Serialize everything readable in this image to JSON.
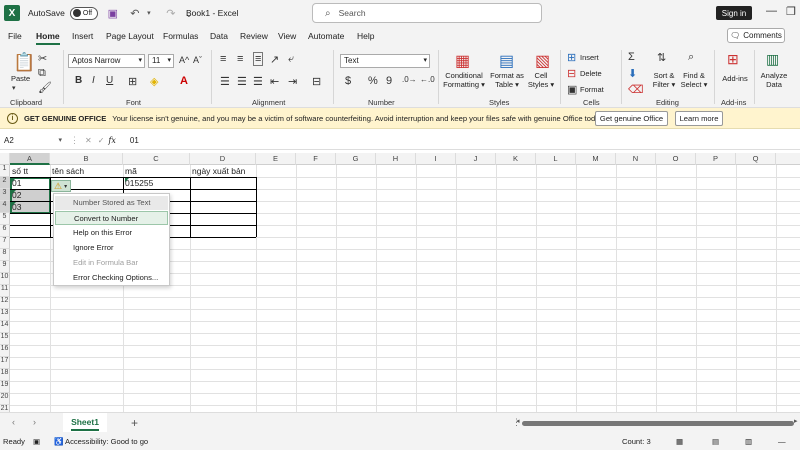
{
  "titlebar": {
    "app_icon": "excel-icon",
    "autosave_label": "AutoSave",
    "autosave_state": "Off",
    "title": "Book1 - Excel",
    "search_placeholder": "Search",
    "signin_label": "Sign in"
  },
  "menu": {
    "tabs": [
      "File",
      "Home",
      "Insert",
      "Page Layout",
      "Formulas",
      "Data",
      "Review",
      "View",
      "Automate",
      "Help"
    ],
    "active": "Home",
    "comments_label": "Comments"
  },
  "ribbon": {
    "clipboard": {
      "paste": "Paste",
      "label": "Clipboard"
    },
    "font": {
      "name": "Aptos Narrow",
      "size": "11",
      "bold": "B",
      "italic": "I",
      "underline": "U",
      "label": "Font"
    },
    "alignment": {
      "label": "Alignment"
    },
    "number": {
      "format": "Text",
      "currency": "$",
      "percent": "%",
      "comma": "9",
      "label": "Number"
    },
    "styles": {
      "conditional": [
        "Conditional",
        "Formatting ▾"
      ],
      "format_table": [
        "Format as",
        "Table ▾"
      ],
      "cell_styles": [
        "Cell",
        "Styles ▾"
      ],
      "label": "Styles"
    },
    "cells": {
      "insert": "Insert",
      "delete": "Delete",
      "format": "Format",
      "label": "Cells"
    },
    "editing": {
      "sort": [
        "Sort &",
        "Filter ▾"
      ],
      "find": [
        "Find &",
        "Select ▾"
      ],
      "label": "Editing"
    },
    "addins": {
      "addins": "Add-ins",
      "label": "Add-ins"
    },
    "analyze": [
      "Analyze",
      "Data"
    ]
  },
  "warning": {
    "title": "GET GENUINE OFFICE",
    "text": "Your license isn't genuine, and you may be a victim of software counterfeiting. Avoid interruption and keep your files safe with genuine Office today.",
    "btn_genuine": "Get genuine Office",
    "btn_learn": "Learn more"
  },
  "formula_bar": {
    "name_box": "A2",
    "fx": "fx",
    "value": "01"
  },
  "grid": {
    "columns": [
      "A",
      "B",
      "C",
      "D",
      "E",
      "F",
      "G",
      "H",
      "I",
      "J",
      "K",
      "L",
      "M",
      "N",
      "O",
      "P",
      "Q"
    ],
    "rows": [
      "1",
      "2",
      "3",
      "4",
      "5",
      "6",
      "7",
      "8",
      "9",
      "10",
      "11",
      "12",
      "13",
      "14",
      "15",
      "16",
      "17",
      "18",
      "19",
      "20",
      "21"
    ],
    "cells": {
      "A1": "số tt",
      "B1": "tên sách",
      "C1": "mã",
      "D1": "ngày xuất bản",
      "A2": "01",
      "A3": "02",
      "A4": "03",
      "C2": "015255"
    }
  },
  "error_menu": {
    "items": [
      "Number Stored as Text",
      "Convert to Number",
      "Help on this Error",
      "Ignore Error",
      "Edit in Formula Bar",
      "Error Checking Options..."
    ]
  },
  "sheets": {
    "tabs": [
      "Sheet1"
    ],
    "add": "+"
  },
  "status": {
    "ready": "Ready",
    "accessibility": "Accessibility: Good to go",
    "count": "Count: 3"
  }
}
